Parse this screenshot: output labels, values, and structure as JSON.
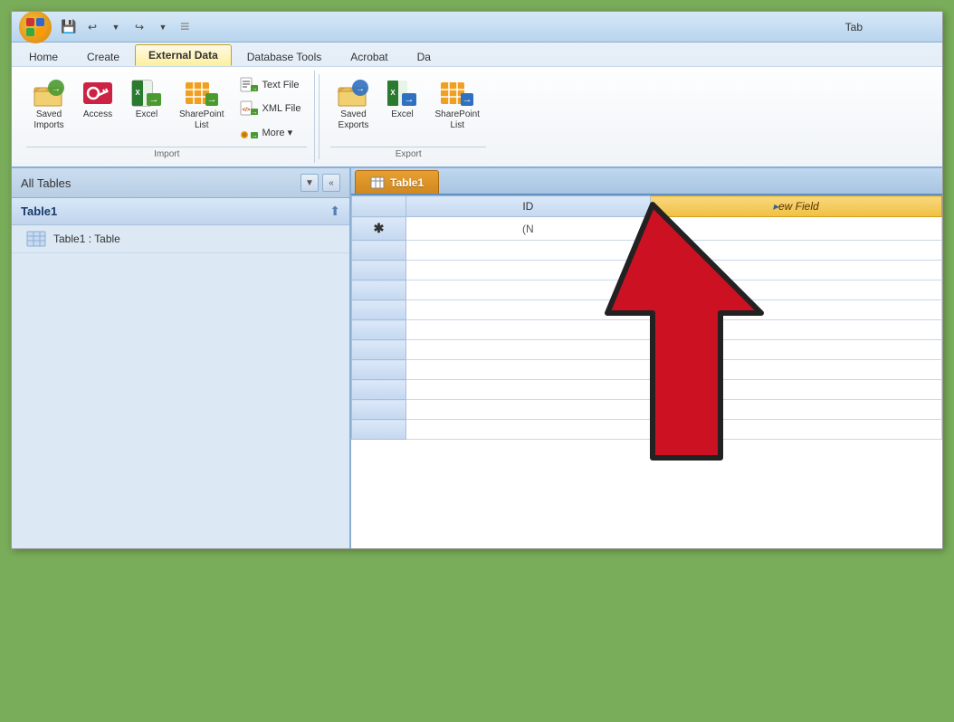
{
  "window": {
    "title": "Tab",
    "office_logo_title": "Office Logo"
  },
  "titlebar": {
    "save_icon": "💾",
    "undo_icon": "↩",
    "redo_icon": "↪",
    "customize_icon": "▼"
  },
  "ribbon": {
    "tabs": [
      {
        "id": "home",
        "label": "Home",
        "active": false
      },
      {
        "id": "create",
        "label": "Create",
        "active": false
      },
      {
        "id": "external_data",
        "label": "External Data",
        "active": true
      },
      {
        "id": "database_tools",
        "label": "Database Tools",
        "active": false
      },
      {
        "id": "acrobat",
        "label": "Acrobat",
        "active": false
      },
      {
        "id": "da",
        "label": "Da",
        "active": false
      }
    ],
    "import_group": {
      "label": "Import",
      "buttons": [
        {
          "id": "saved_imports",
          "label": "Saved\nImports",
          "lines": [
            "Saved",
            "Imports"
          ]
        },
        {
          "id": "access",
          "label": "Access",
          "lines": [
            "Access"
          ]
        },
        {
          "id": "excel",
          "label": "Excel",
          "lines": [
            "Excel"
          ]
        },
        {
          "id": "sharepoint_list",
          "label": "SharePoint\nList",
          "lines": [
            "SharePoint",
            "List"
          ]
        }
      ],
      "small_buttons": [
        {
          "id": "text_file",
          "label": "Text File"
        },
        {
          "id": "xml_file",
          "label": "XML File"
        },
        {
          "id": "more",
          "label": "More"
        }
      ]
    },
    "export_group": {
      "label": "Export",
      "buttons": [
        {
          "id": "saved_exports",
          "label": "Saved\nExports",
          "lines": [
            "Saved",
            "Exports"
          ]
        },
        {
          "id": "excel_export",
          "label": "Excel",
          "lines": [
            "Excel"
          ]
        },
        {
          "id": "sharepoint_list_export",
          "label": "SharePoint\nList",
          "lines": [
            "SharePoint",
            "List"
          ]
        }
      ]
    }
  },
  "navigation": {
    "title": "All Tables",
    "filter_icon": "▼",
    "collapse_icon": "«",
    "section_title": "Table1",
    "section_icon": "⬆",
    "items": [
      {
        "id": "table1",
        "label": "Table1 : Table"
      }
    ]
  },
  "table_tab": {
    "label": "Table1"
  },
  "table": {
    "columns": [
      {
        "id": "row_marker",
        "label": ""
      },
      {
        "id": "id",
        "label": "ID"
      },
      {
        "id": "new_field",
        "label": "▸ew Field"
      }
    ],
    "rows": [
      {
        "row_marker": "✱",
        "id": "(N",
        "new_field": ""
      }
    ]
  }
}
